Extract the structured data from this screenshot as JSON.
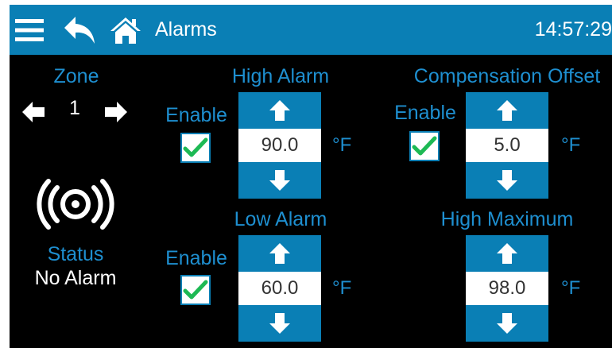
{
  "header": {
    "title": "Alarms",
    "time": "14:57:29"
  },
  "icons": {
    "menu": "menu-icon",
    "back": "back-arrow-icon",
    "home": "home-icon",
    "status": "alarm-sound-icon"
  },
  "zone": {
    "label": "Zone",
    "value": "1"
  },
  "status": {
    "label": "Status",
    "value": "No Alarm"
  },
  "high_alarm": {
    "label": "High Alarm",
    "enable_label": "Enable",
    "enabled": true,
    "value": "90.0",
    "unit": "°F"
  },
  "low_alarm": {
    "label": "Low Alarm",
    "enable_label": "Enable",
    "enabled": true,
    "value": "60.0",
    "unit": "°F"
  },
  "compensation_offset": {
    "label": "Compensation Offset",
    "enable_label": "Enable",
    "enabled": true,
    "value": "5.0",
    "unit": "°F"
  },
  "high_maximum": {
    "label": "High Maximum",
    "value": "98.0",
    "unit": "°F"
  },
  "colors": {
    "accent": "#0a7fb5",
    "label_blue": "#1e8fd0",
    "check_green": "#1db954",
    "background": "#000000"
  }
}
